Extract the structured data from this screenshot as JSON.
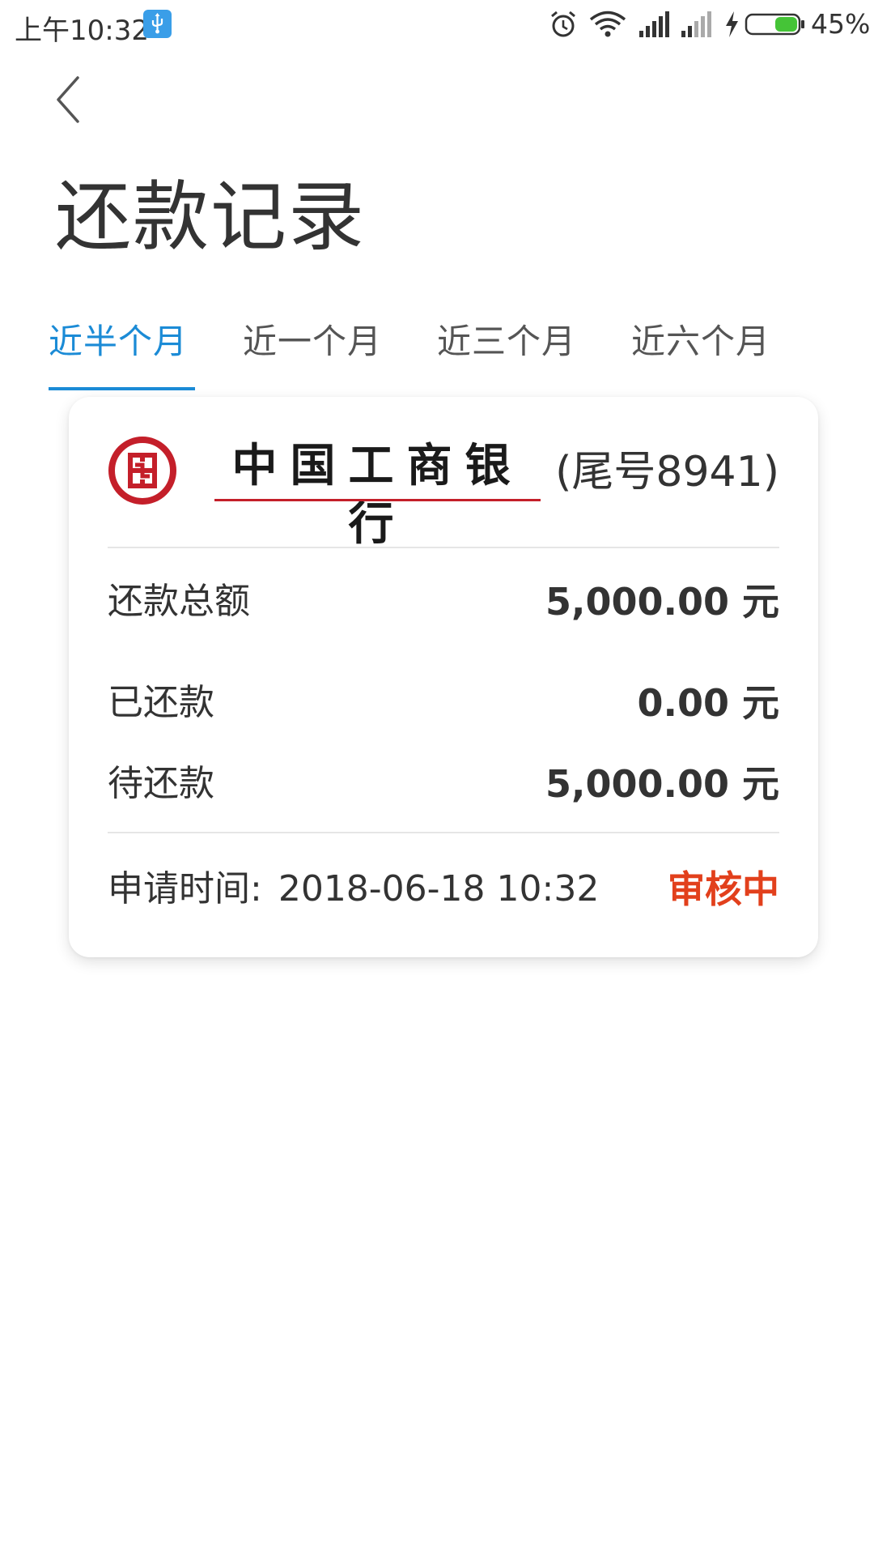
{
  "status_bar": {
    "time": "上午10:32",
    "battery_percent": "45%",
    "battery_level": 0.45,
    "icons": [
      "usb-debug-icon",
      "alarm-icon",
      "wifi-icon",
      "signal-icon",
      "signal-icon",
      "charging-icon",
      "battery-icon"
    ]
  },
  "header": {
    "back_icon": "chevron-left-icon",
    "title": "还款记录"
  },
  "tabs": [
    {
      "label": "近半个月",
      "active": true
    },
    {
      "label": "近一个月",
      "active": false
    },
    {
      "label": "近三个月",
      "active": false
    },
    {
      "label": "近六个月",
      "active": false
    }
  ],
  "record": {
    "bank_logo": "icbc-logo",
    "bank_name": "中国工商银行",
    "card_suffix": "(尾号8941)",
    "rows": [
      {
        "label": "还款总额",
        "value": "5,000.00 元"
      },
      {
        "label": "已还款",
        "value": "0.00 元"
      },
      {
        "label": "待还款",
        "value": "5,000.00 元"
      }
    ],
    "apply_time_label": "申请时间:",
    "apply_time_value": "2018-06-18 10:32",
    "status": "审核中"
  },
  "colors": {
    "accent": "#1b8bd6",
    "status": "#e2401c",
    "brand_red": "#c41f2a",
    "text": "#333333"
  }
}
